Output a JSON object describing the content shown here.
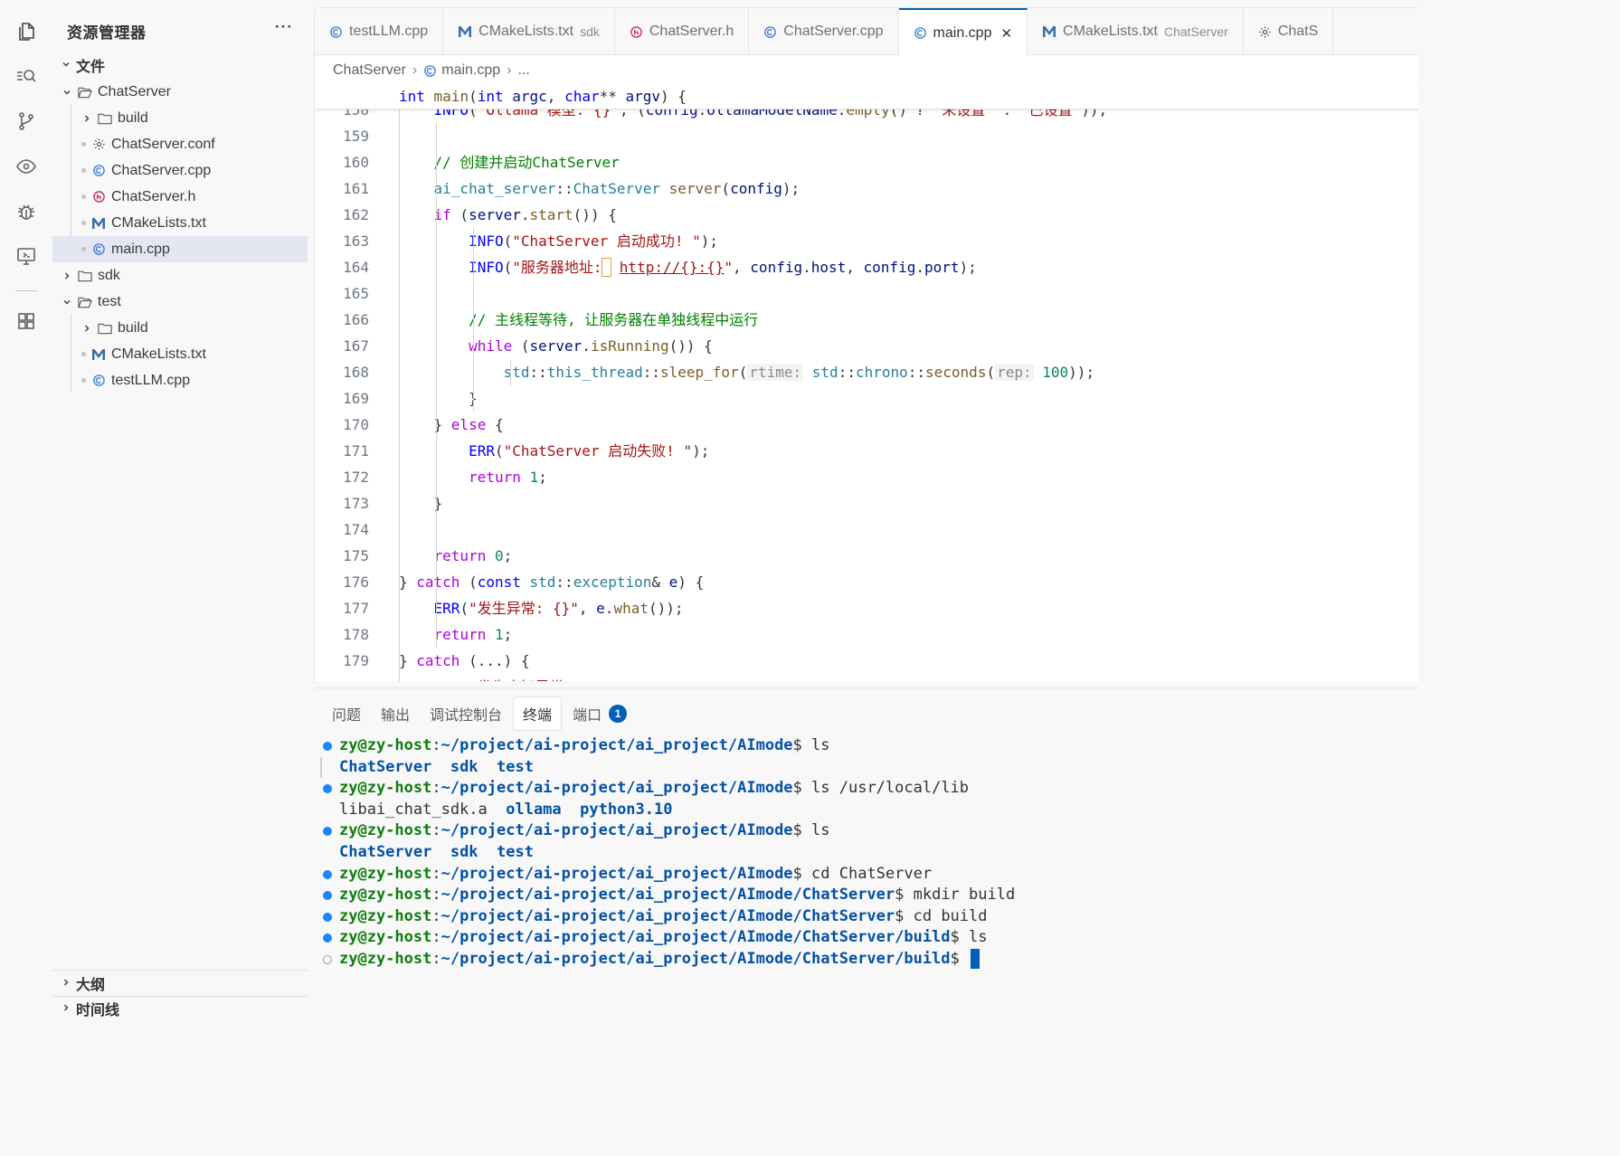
{
  "sidebar": {
    "title": "资源管理器",
    "more": "···",
    "section_files": "文件",
    "tree": [
      {
        "label": "ChatServer",
        "kind": "folder-open",
        "depth": 1
      },
      {
        "label": "build",
        "kind": "folder",
        "depth": 2
      },
      {
        "label": "ChatServer.conf",
        "kind": "gear",
        "depth": 2
      },
      {
        "label": "ChatServer.cpp",
        "kind": "cpp",
        "depth": 2
      },
      {
        "label": "ChatServer.h",
        "kind": "h",
        "depth": 2
      },
      {
        "label": "CMakeLists.txt",
        "kind": "cmake",
        "depth": 2
      },
      {
        "label": "main.cpp",
        "kind": "cpp",
        "depth": 2,
        "selected": true
      },
      {
        "label": "sdk",
        "kind": "folder",
        "depth": 1
      },
      {
        "label": "test",
        "kind": "folder-open",
        "depth": 1
      },
      {
        "label": "build",
        "kind": "folder",
        "depth": 2
      },
      {
        "label": "CMakeLists.txt",
        "kind": "cmake",
        "depth": 2
      },
      {
        "label": "testLLM.cpp",
        "kind": "cpp",
        "depth": 2
      }
    ],
    "section_outline": "大纲",
    "section_timeline": "时间线"
  },
  "tabs": [
    {
      "label": "testLLM.cpp",
      "desc": "",
      "icon": "cpp"
    },
    {
      "label": "CMakeLists.txt",
      "desc": "sdk",
      "icon": "cmake"
    },
    {
      "label": "ChatServer.h",
      "desc": "",
      "icon": "h"
    },
    {
      "label": "ChatServer.cpp",
      "desc": "",
      "icon": "cpp"
    },
    {
      "label": "main.cpp",
      "desc": "",
      "icon": "cpp",
      "active": true
    },
    {
      "label": "CMakeLists.txt",
      "desc": "ChatServer",
      "icon": "cmake"
    },
    {
      "label": "ChatS",
      "desc": "",
      "icon": "gear"
    }
  ],
  "breadcrumb": {
    "folder": "ChatServer",
    "file": "main.cpp",
    "more": "..."
  },
  "sticky_scroll": "int main(int argc, char** argv) {",
  "code_lines": [
    {
      "n": 158,
      "text": "    INFO(\"Ollama 模型: {}\", (config.ollamaModelName.empty() ? \"未设置\" : \"已设置\"));"
    },
    {
      "n": 159,
      "text": ""
    },
    {
      "n": 160,
      "text": "    // 创建并启动ChatServer"
    },
    {
      "n": 161,
      "text": "    ai_chat_server::ChatServer server(config);"
    },
    {
      "n": 162,
      "text": "    if (server.start()) {"
    },
    {
      "n": 163,
      "text": "        INFO(\"ChatServer 启动成功! \");"
    },
    {
      "n": 164,
      "text": "        INFO(\"服务器地址: http://{}:{}\", config.host, config.port);"
    },
    {
      "n": 165,
      "text": ""
    },
    {
      "n": 166,
      "text": "        // 主线程等待, 让服务器在单独线程中运行"
    },
    {
      "n": 167,
      "text": "        while (server.isRunning()) {"
    },
    {
      "n": 168,
      "text": "            std::this_thread::sleep_for(rtime: std::chrono::seconds(rep: 100));"
    },
    {
      "n": 169,
      "text": "        }"
    },
    {
      "n": 170,
      "text": "    } else {"
    },
    {
      "n": 171,
      "text": "        ERR(\"ChatServer 启动失败! \");"
    },
    {
      "n": 172,
      "text": "        return 1;"
    },
    {
      "n": 173,
      "text": "    }"
    },
    {
      "n": 174,
      "text": ""
    },
    {
      "n": 175,
      "text": "    return 0;"
    },
    {
      "n": 176,
      "text": "} catch (const std::exception& e) {"
    },
    {
      "n": 177,
      "text": "    ERR(\"发生异常: {}\", e.what());"
    },
    {
      "n": 178,
      "text": "    return 1;"
    },
    {
      "n": 179,
      "text": "} catch (...) {"
    },
    {
      "n": 180,
      "text": "    ERR(\"发生未知异常\");"
    }
  ],
  "panel": {
    "tabs": [
      "问题",
      "输出",
      "调试控制台",
      "终端",
      "端口"
    ],
    "active_tab": "终端",
    "ports_badge": "1"
  },
  "terminal": [
    {
      "mark": "filled",
      "user": "zy@zy-host",
      "path": "~/project/ai-project/ai_project/AImode",
      "cmd": " ls"
    },
    {
      "mark": "bar",
      "output": [
        [
          "ChatServer",
          "dir"
        ],
        [
          "sdk",
          "dir"
        ],
        [
          "test",
          "dir"
        ]
      ]
    },
    {
      "mark": "filled",
      "user": "zy@zy-host",
      "path": "~/project/ai-project/ai_project/AImode",
      "cmd": " ls /usr/local/lib"
    },
    {
      "mark": "none",
      "output": [
        [
          "libai_chat_sdk.a",
          "file"
        ],
        [
          "ollama",
          "dir"
        ],
        [
          "python3.10",
          "dir"
        ]
      ]
    },
    {
      "mark": "filled",
      "user": "zy@zy-host",
      "path": "~/project/ai-project/ai_project/AImode",
      "cmd": " ls"
    },
    {
      "mark": "none",
      "output": [
        [
          "ChatServer",
          "dir"
        ],
        [
          "sdk",
          "dir"
        ],
        [
          "test",
          "dir"
        ]
      ]
    },
    {
      "mark": "filled",
      "user": "zy@zy-host",
      "path": "~/project/ai-project/ai_project/AImode",
      "cmd": " cd ChatServer"
    },
    {
      "mark": "filled",
      "user": "zy@zy-host",
      "path": "~/project/ai-project/ai_project/AImode/ChatServer",
      "cmd": " mkdir build"
    },
    {
      "mark": "filled",
      "user": "zy@zy-host",
      "path": "~/project/ai-project/ai_project/AImode/ChatServer",
      "cmd": " cd build"
    },
    {
      "mark": "filled",
      "user": "zy@zy-host",
      "path": "~/project/ai-project/ai_project/AImode/ChatServer/build",
      "cmd": " ls"
    },
    {
      "mark": "hollow",
      "user": "zy@zy-host",
      "path": "~/project/ai-project/ai_project/AImode/ChatServer/build",
      "cmd": " ",
      "cursor": true
    }
  ],
  "colors": {
    "accent": "#005fb8",
    "selection": "#e4e6f1",
    "prompt_user": "#0e7e0e",
    "prompt_path": "#0451a5"
  },
  "activity_icons": [
    "explorer-icon",
    "search-icon",
    "source-control-icon",
    "preview-icon",
    "debug-icon",
    "remote-explorer-icon",
    "extensions-icon"
  ]
}
